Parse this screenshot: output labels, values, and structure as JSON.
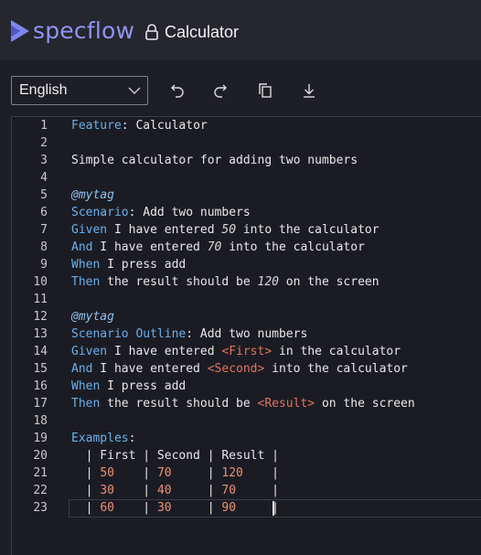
{
  "brand": {
    "name": "specflow"
  },
  "project": {
    "title": "Calculator"
  },
  "toolbar": {
    "language": "English",
    "undo_icon": "undo-icon",
    "redo_icon": "redo-icon",
    "copy_icon": "copy-icon",
    "download_icon": "download-icon"
  },
  "colors": {
    "keyword": "#68b0ec",
    "tag": "#8fc2ee",
    "placeholder": "#e0745f",
    "table_value": "#ec8f7a",
    "brand": "#8f95f5"
  },
  "editor": {
    "line_numbers": [
      "1",
      "2",
      "3",
      "4",
      "5",
      "6",
      "7",
      "8",
      "9",
      "10",
      "11",
      "12",
      "13",
      "14",
      "15",
      "16",
      "17",
      "18",
      "19",
      "20",
      "21",
      "22",
      "23"
    ],
    "lines": [
      [
        {
          "t": "kw",
          "v": "Feature"
        },
        {
          "t": "p",
          "v": ": Calculator"
        }
      ],
      [],
      [
        {
          "t": "p",
          "v": "Simple calculator for adding two numbers"
        }
      ],
      [],
      [
        {
          "t": "tag",
          "v": "@mytag"
        }
      ],
      [
        {
          "t": "kw",
          "v": "Scenario"
        },
        {
          "t": "p",
          "v": ": Add two numbers"
        }
      ],
      [
        {
          "t": "kw",
          "v": "Given"
        },
        {
          "t": "p",
          "v": " I have entered "
        },
        {
          "t": "num",
          "v": "50"
        },
        {
          "t": "p",
          "v": " into the calculator"
        }
      ],
      [
        {
          "t": "kw",
          "v": "And"
        },
        {
          "t": "p",
          "v": " I have entered "
        },
        {
          "t": "num",
          "v": "70"
        },
        {
          "t": "p",
          "v": " into the calculator"
        }
      ],
      [
        {
          "t": "kw",
          "v": "When"
        },
        {
          "t": "p",
          "v": " I press add"
        }
      ],
      [
        {
          "t": "kw",
          "v": "Then"
        },
        {
          "t": "p",
          "v": " the result should be "
        },
        {
          "t": "num",
          "v": "120"
        },
        {
          "t": "p",
          "v": " on the screen"
        }
      ],
      [],
      [
        {
          "t": "tag",
          "v": "@mytag"
        }
      ],
      [
        {
          "t": "kw",
          "v": "Scenario Outline"
        },
        {
          "t": "p",
          "v": ": Add two numbers"
        }
      ],
      [
        {
          "t": "kw",
          "v": "Given"
        },
        {
          "t": "p",
          "v": " I have entered "
        },
        {
          "t": "ph",
          "v": "<First>"
        },
        {
          "t": "p",
          "v": " in the calculator"
        }
      ],
      [
        {
          "t": "kw",
          "v": "And"
        },
        {
          "t": "p",
          "v": " I have entered "
        },
        {
          "t": "ph",
          "v": "<Second>"
        },
        {
          "t": "p",
          "v": " into the calculator"
        }
      ],
      [
        {
          "t": "kw",
          "v": "When"
        },
        {
          "t": "p",
          "v": " I press add"
        }
      ],
      [
        {
          "t": "kw",
          "v": "Then"
        },
        {
          "t": "p",
          "v": " the result should be "
        },
        {
          "t": "ph",
          "v": "<Result>"
        },
        {
          "t": "p",
          "v": " on the screen"
        }
      ],
      [],
      [
        {
          "t": "kw",
          "v": "Examples"
        },
        {
          "t": "p",
          "v": ":"
        }
      ],
      [
        {
          "t": "p",
          "v": "  | First | Second | Result |"
        }
      ],
      [
        {
          "t": "p",
          "v": "  | "
        },
        {
          "t": "val",
          "v": "50   "
        },
        {
          "t": "p",
          "v": " | "
        },
        {
          "t": "val",
          "v": "70    "
        },
        {
          "t": "p",
          "v": " | "
        },
        {
          "t": "val",
          "v": "120   "
        },
        {
          "t": "p",
          "v": " |"
        }
      ],
      [
        {
          "t": "p",
          "v": "  | "
        },
        {
          "t": "val",
          "v": "30   "
        },
        {
          "t": "p",
          "v": " | "
        },
        {
          "t": "val",
          "v": "40    "
        },
        {
          "t": "p",
          "v": " | "
        },
        {
          "t": "val",
          "v": "70    "
        },
        {
          "t": "p",
          "v": " |"
        }
      ],
      [
        {
          "t": "p",
          "v": "  | "
        },
        {
          "t": "val",
          "v": "60   "
        },
        {
          "t": "p",
          "v": " | "
        },
        {
          "t": "val",
          "v": "30    "
        },
        {
          "t": "p",
          "v": " | "
        },
        {
          "t": "val",
          "v": "90    "
        },
        {
          "t": "p",
          "v": " |"
        }
      ]
    ]
  }
}
